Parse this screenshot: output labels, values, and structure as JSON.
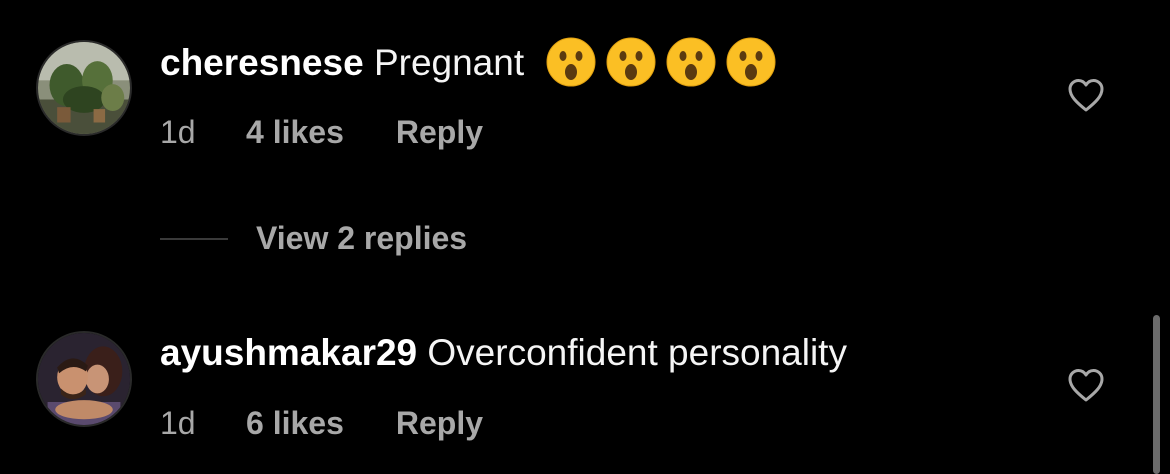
{
  "comments": [
    {
      "username": "cheresnese",
      "text": "Pregnant",
      "emojis": [
        "astonished-face-icon",
        "astonished-face-icon",
        "astonished-face-icon",
        "astonished-face-icon"
      ],
      "time": "1d",
      "likes": "4 likes",
      "reply_label": "Reply",
      "view_replies": "View 2 replies"
    },
    {
      "username": "ayushmakar29",
      "text": "Overconfident personality",
      "time": "1d",
      "likes": "6 likes",
      "reply_label": "Reply"
    }
  ],
  "colors": {
    "background": "#000000",
    "primary_text": "#f5f5f5",
    "secondary_text": "#a8a8a8",
    "emoji_yellow": "#fbbf24"
  }
}
